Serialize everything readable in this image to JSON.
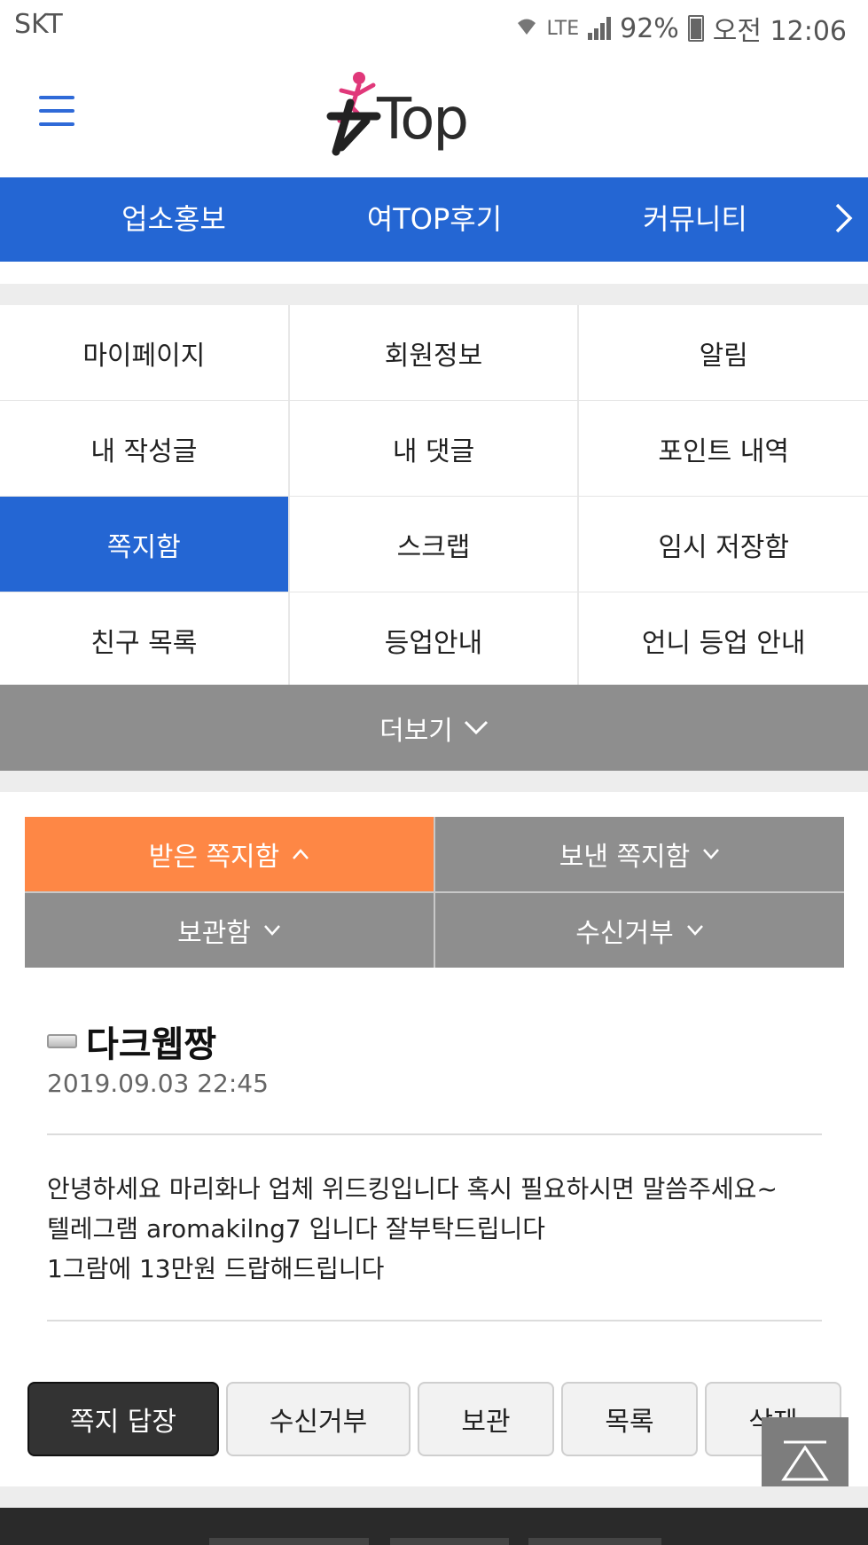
{
  "status_bar": {
    "carrier": "SKT",
    "network": "LTE",
    "battery": "92%",
    "time": "오전 12:06"
  },
  "header": {
    "logo_text": "女Top",
    "brand_color": "#2466d3"
  },
  "main_nav": {
    "items": [
      "업소홍보",
      "여TOP후기",
      "커뮤니티"
    ],
    "next_icon": "chevron-right-icon"
  },
  "menu": {
    "rows": [
      [
        "마이페이지",
        "회원정보",
        "알림"
      ],
      [
        "내 작성글",
        "내 댓글",
        "포인트 내역"
      ],
      [
        "쪽지함",
        "스크랩",
        "임시 저장함"
      ],
      [
        "친구 목록",
        "등업안내",
        "언니 등업 안내"
      ]
    ],
    "active": "쪽지함",
    "more_label": "더보기"
  },
  "message_tabs": {
    "received": "받은 쪽지함",
    "sent": "보낸 쪽지함",
    "archive": "보관함",
    "blocked": "수신거부",
    "active_color": "#fe8745"
  },
  "message": {
    "sender": "다크웹짱",
    "date": "2019.09.03 22:45",
    "lines": [
      "안녕하세요 마리화나 업체 위드킹입니다 혹시 필요하시면 말씀주세요~",
      "텔레그램 aromakilng7 입니다 잘부탁드립니다",
      "1그람에 13만원 드랍해드립니다"
    ]
  },
  "actions": {
    "reply": "쪽지 답장",
    "block": "수신거부",
    "save": "보관",
    "list": "목록",
    "delete": "삭제"
  }
}
